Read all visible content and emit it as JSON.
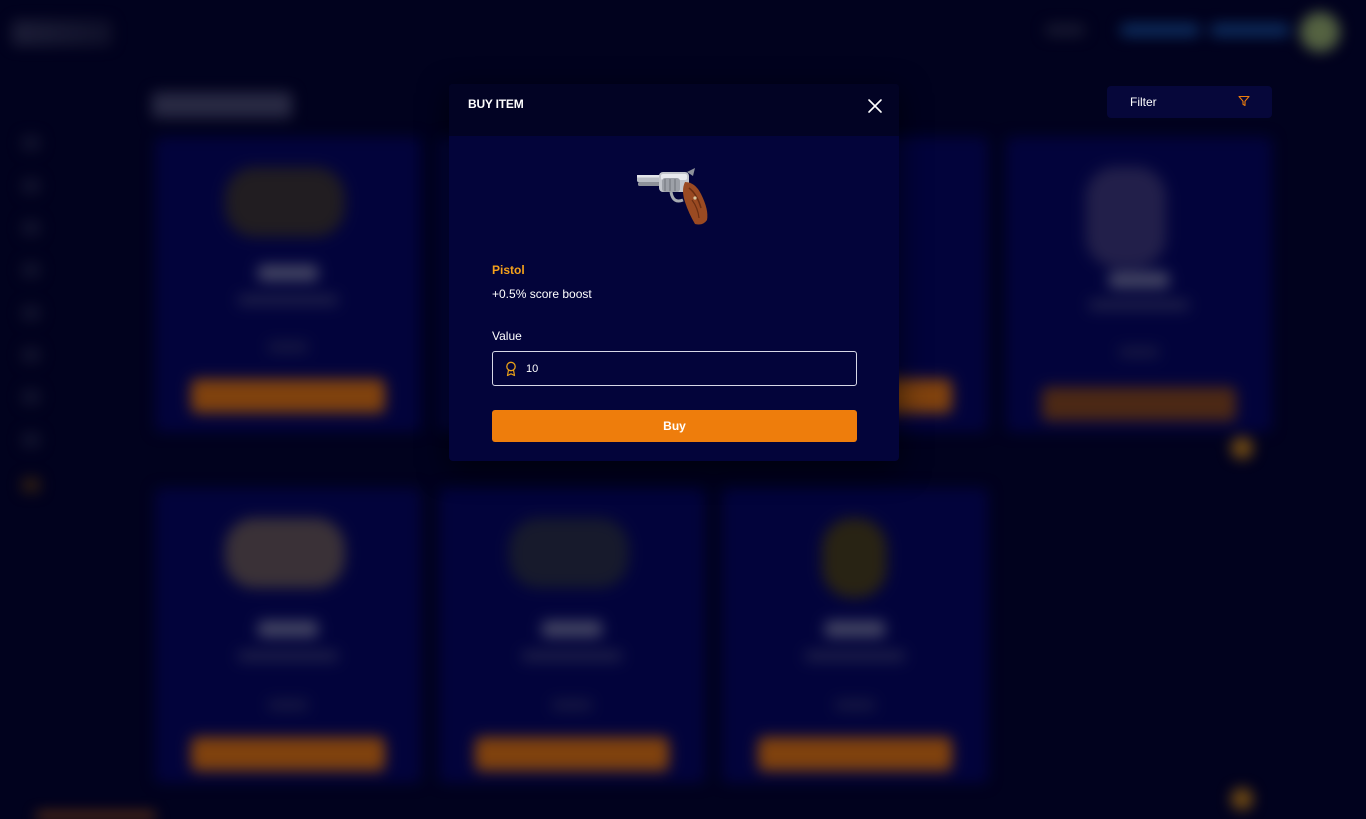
{
  "modal": {
    "title": "BUY ITEM",
    "item": {
      "name": "Pistol",
      "description": "+0.5% score boost",
      "icon": "revolver-icon"
    },
    "value": {
      "label": "Value",
      "current": "10",
      "icon": "medal-icon"
    },
    "buy_label": "Buy",
    "close_icon": "close-icon"
  },
  "filter": {
    "label": "Filter",
    "icon": "funnel-icon"
  },
  "colors": {
    "accent_orange": "#ee7d0c",
    "item_name_gold": "#f5a21b",
    "modal_bg": "#03043a",
    "page_bg": "#03042a"
  }
}
